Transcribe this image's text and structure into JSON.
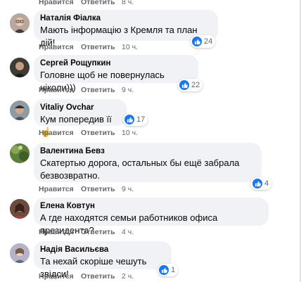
{
  "top_partial": {
    "like": "Нравится",
    "reply": "Ответить",
    "time": "8 ч."
  },
  "comments": [
    {
      "author": "Наталія Фіалка",
      "text": "Мають інформацію з Кремля та план дій!",
      "reactions": "24",
      "like": "Нравится",
      "reply": "Ответить",
      "time": "10 ч.",
      "avatar": "avatar-woman-glasses"
    },
    {
      "author": "Сергей Рощупкин",
      "text": "Головне щоб не повернулась ніколи)))",
      "reactions": "22",
      "like": "Нравится",
      "reply": "Ответить",
      "time": "9 ч.",
      "avatar": "avatar-man-dark"
    },
    {
      "author": "Vitaliy Ovchar",
      "text": "Кум попередив її☝",
      "reactions": "17",
      "like": "Нравится",
      "reply": "Ответить",
      "time": "10 ч.",
      "avatar": "avatar-man-cap"
    },
    {
      "author": "Валентина Бевз",
      "text": "Скатертью дорога, остальных бы ещё забрала безвозвратно.",
      "reactions": "4",
      "like": "Нравится",
      "reply": "Ответить",
      "time": "9 ч.",
      "avatar": "avatar-greenery"
    },
    {
      "author": "Елена Ковтун",
      "text": "А где находятся семьи работников офиса президента?",
      "reactions": "",
      "like": "Нравится",
      "reply": "Ответить",
      "time": "4 ч.",
      "avatar": "avatar-woman-dark"
    },
    {
      "author": "Надія Васильєва",
      "text": "Та нехай скоріше чешуть звідси!",
      "reactions": "1",
      "like": "Нравится",
      "reply": "Ответить",
      "time": "2 ч.",
      "avatar": "avatar-woman-light"
    }
  ]
}
